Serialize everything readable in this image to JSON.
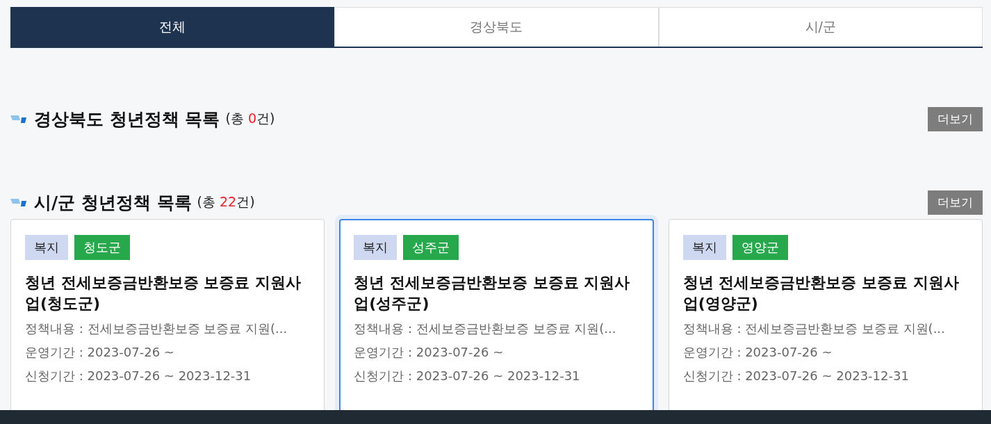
{
  "tabs": [
    {
      "label": "전체",
      "selected": true
    },
    {
      "label": "경상북도",
      "selected": false
    },
    {
      "label": "시/군",
      "selected": false
    }
  ],
  "sections": [
    {
      "title": "경상북도 청년정책 목록",
      "count_prefix": "(총 ",
      "count": "0",
      "count_suffix": "건)",
      "more_button": "더보기"
    },
    {
      "title": "시/군 청년정책 목록",
      "count_prefix": "(총 ",
      "count": "22",
      "count_suffix": "건)",
      "more_button": "더보기",
      "cards": [
        {
          "selected": false,
          "category": "복지",
          "region": "청도군",
          "title": "청년 전세보증금반환보증 보증료 지원사업(청도군)",
          "lines": [
            "정책내용 : 전세보증금반환보증 보증료 지원(...",
            "운영기간 : 2023-07-26 ~",
            "신청기간 : 2023-07-26 ~ 2023-12-31"
          ]
        },
        {
          "selected": true,
          "category": "복지",
          "region": "성주군",
          "title": "청년 전세보증금반환보증 보증료 지원사업(성주군)",
          "lines": [
            "정책내용 : 전세보증금반환보증 보증료 지원(...",
            "운영기간 : 2023-07-26 ~",
            "신청기간 : 2023-07-26 ~ 2023-12-31"
          ]
        },
        {
          "selected": false,
          "category": "복지",
          "region": "영양군",
          "title": "청년 전세보증금반환보증 보증료 지원사업(영양군)",
          "lines": [
            "정책내용 : 전세보증금반환보증 보증료 지원(...",
            "운영기간 : 2023-07-26 ~",
            "신청기간 : 2023-07-26 ~ 2023-12-31"
          ]
        }
      ]
    }
  ]
}
